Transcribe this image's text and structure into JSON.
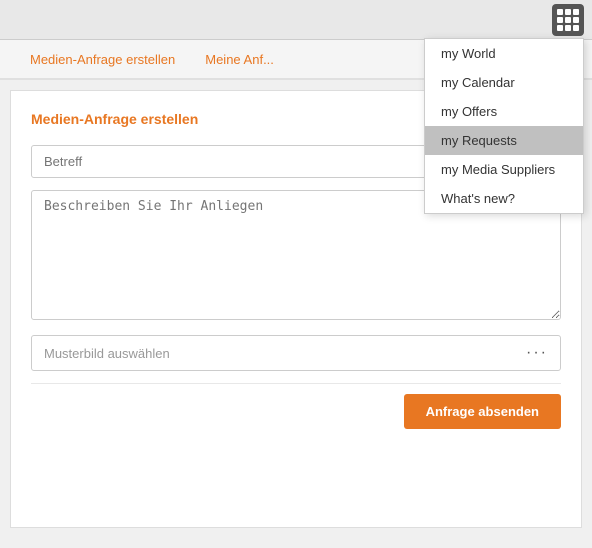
{
  "topbar": {
    "icon_label": "grid-menu"
  },
  "nav": {
    "tab1_label": "Medien-Anfrage erstellen",
    "tab2_label": "Meine Anf..."
  },
  "page": {
    "title": "Medien-Anfrage erstellen",
    "subject_placeholder": "Betreff",
    "description_placeholder": "Beschreiben Sie Ihr Anliegen",
    "file_placeholder": "Musterbild auswählen",
    "submit_label": "Anfrage absenden"
  },
  "dropdown": {
    "items": [
      {
        "label": "my World",
        "selected": false
      },
      {
        "label": "my Calendar",
        "selected": false
      },
      {
        "label": "my Offers",
        "selected": false
      },
      {
        "label": "my Requests",
        "selected": true
      },
      {
        "label": "my Media Suppliers",
        "selected": false
      },
      {
        "label": "What's new?",
        "selected": false
      }
    ]
  }
}
